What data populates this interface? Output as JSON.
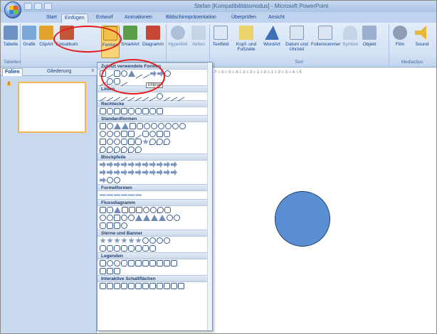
{
  "window": {
    "title": "Stefan [Kompatibilitätsmodus] - Microsoft PowerPoint"
  },
  "tabs": [
    {
      "label": "Start"
    },
    {
      "label": "Einfügen"
    },
    {
      "label": "Entwurf"
    },
    {
      "label": "Animationen"
    },
    {
      "label": "Bildschirmpräsentation"
    },
    {
      "label": "Überprüfen"
    },
    {
      "label": "Ansicht"
    }
  ],
  "ribbon": {
    "buttons": [
      {
        "label": "Tabelle",
        "icon": "table-icon",
        "color": "#6f92c4"
      },
      {
        "label": "Grafik",
        "icon": "picture-icon",
        "color": "#7ba7d8"
      },
      {
        "label": "ClipArt",
        "icon": "clipart-icon",
        "color": "#e2a32d"
      },
      {
        "label": "Fotoalbum",
        "icon": "photo-album-icon",
        "color": "#c25636"
      },
      {
        "label": "Formen",
        "icon": "shapes-icon",
        "color": "#f2c14a"
      },
      {
        "label": "SmartArt",
        "icon": "smartart-icon",
        "color": "#5b9c47"
      },
      {
        "label": "Diagramm",
        "icon": "chart-icon",
        "color": "#c74634"
      },
      {
        "label": "Hyperlink",
        "icon": "hyperlink-icon",
        "color": "#8fa4c3"
      },
      {
        "label": "Aktion",
        "icon": "action-icon",
        "color": "#b6c6dd"
      },
      {
        "label": "Textfeld",
        "icon": "textbox-icon",
        "color": "#dde7f5"
      },
      {
        "label": "Kopf- und Fußzeile",
        "icon": "header-footer-icon",
        "color": "#e9d36a"
      },
      {
        "label": "WordArt",
        "icon": "wordart-icon",
        "color": "#3f6fb5"
      },
      {
        "label": "Datum und Uhrzeit",
        "icon": "date-time-icon",
        "color": "#dbe4f1"
      },
      {
        "label": "Foliennummer",
        "icon": "slide-number-icon",
        "color": "#dbe4f1"
      },
      {
        "label": "Symbol",
        "icon": "symbol-icon",
        "color": "#b6c6dd"
      },
      {
        "label": "Objekt",
        "icon": "object-icon",
        "color": "#9aaed0"
      },
      {
        "label": "Film",
        "icon": "film-icon",
        "color": "#8e9db5"
      },
      {
        "label": "Sound",
        "icon": "sound-icon",
        "color": "#e7b73a"
      }
    ],
    "groups": [
      {
        "label": "Tabellen"
      },
      {
        "label": "Text"
      },
      {
        "label": "Mediaclips"
      }
    ]
  },
  "left_panel": {
    "tabs": [
      {
        "label": "Folien"
      },
      {
        "label": "Gliederung"
      }
    ],
    "close": "x",
    "slide_number": "1"
  },
  "ruler": {
    "text": "·7·i·6·i·5·i·4·i·3·i·2·i·1·i·0·i·1·i·2·i·3·i·4·i·5"
  },
  "shapes_menu": {
    "tooltip": "Ellipse",
    "sections": [
      {
        "title": "Zuletzt verwendete Formen",
        "rows": [
          [
            "r",
            "l",
            "r",
            "c",
            "t",
            "l",
            "l",
            "a",
            "a",
            "c"
          ],
          [
            "l",
            "o",
            "b",
            "l"
          ]
        ]
      },
      {
        "title": "Linien",
        "rows": [
          [
            "l",
            "l",
            "l",
            "l",
            "l",
            "l",
            "l",
            "l",
            "c",
            "l",
            "l",
            "l"
          ]
        ]
      },
      {
        "title": "Rechtecke",
        "rows": [
          [
            "r",
            "b",
            "r",
            "r",
            "b",
            "b",
            "r",
            "b",
            "r"
          ]
        ]
      },
      {
        "title": "Standardformen",
        "rows": [
          [
            "r",
            "c",
            "t",
            "t",
            "r",
            "b",
            "c",
            "c",
            "c",
            "c",
            "c",
            "c"
          ],
          [
            "c",
            "c",
            "c",
            "r",
            "r",
            "l",
            "b",
            "c",
            "r",
            "b"
          ],
          [
            "r",
            "c",
            "c",
            "b",
            "r",
            "b",
            "s",
            "o",
            "o",
            "o"
          ],
          [
            "o",
            "o",
            "o",
            "o",
            "o",
            "o"
          ]
        ]
      },
      {
        "title": "Blockpfeile",
        "rows": [
          [
            "a",
            "a",
            "a",
            "a",
            "a",
            "a",
            "a",
            "a",
            "a",
            "a",
            "a"
          ],
          [
            "a",
            "a",
            "a",
            "a",
            "a",
            "a",
            "a",
            "a",
            "a",
            "a",
            "a"
          ],
          [
            "a",
            "c",
            "c"
          ]
        ]
      },
      {
        "title": "Formelformen",
        "rows": [
          [
            "f",
            "f",
            "f",
            "f",
            "f",
            "f"
          ]
        ]
      },
      {
        "title": "Flussdiagramm",
        "rows": [
          [
            "r",
            "b",
            "t",
            "r",
            "r",
            "r",
            "c",
            "c",
            "o",
            "b"
          ],
          [
            "c",
            "c",
            "r",
            "c",
            "c",
            "t",
            "t",
            "t",
            "t",
            "c",
            "c"
          ],
          [
            "b",
            "r",
            "r",
            "c"
          ]
        ]
      },
      {
        "title": "Sterne und Banner",
        "rows": [
          [
            "s",
            "s",
            "s",
            "s",
            "s",
            "s",
            "c",
            "c",
            "c",
            "c"
          ],
          [
            "b",
            "b",
            "b",
            "b",
            "b",
            "b",
            "b",
            "b"
          ]
        ]
      },
      {
        "title": "Legenden",
        "rows": [
          [
            "r",
            "c",
            "c",
            "b",
            "r",
            "r",
            "r",
            "r",
            "r",
            "r",
            "r"
          ],
          [
            "r",
            "r",
            "r"
          ]
        ]
      },
      {
        "title": "Interaktive Schaltflächen",
        "rows": [
          [
            "r",
            "r",
            "r",
            "r",
            "r",
            "r",
            "r",
            "r",
            "r",
            "r",
            "r",
            "r"
          ]
        ]
      }
    ]
  },
  "colors": {
    "circle_fill": "#5b8fd4",
    "highlight": "#e21c1c"
  }
}
